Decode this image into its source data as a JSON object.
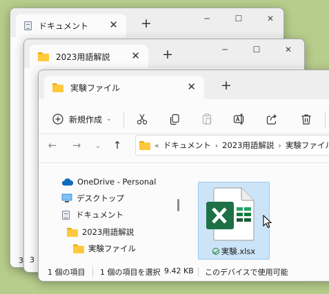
{
  "colors": {
    "desktop": "#b6cd8b",
    "selection": "#cce4f7",
    "excel": "#1e7145"
  },
  "windows": {
    "back": {
      "tab_title": "ドキュメント",
      "tab_icon": "document-icon",
      "status_fragment": "3"
    },
    "middle": {
      "tab_title": "2023用語解説",
      "tab_icon": "folder-icon",
      "status_fragment": "3"
    },
    "front": {
      "tab_title": "実験ファイル",
      "tab_icon": "folder-icon",
      "toolbar": {
        "new_label": "新規作成",
        "buttons": [
          "cut-icon",
          "copy-icon",
          "paste-icon",
          "rename-icon",
          "share-icon",
          "delete-icon"
        ]
      },
      "address": {
        "overflow": "«",
        "crumbs": [
          "ドキュメント",
          "2023用語解説",
          "実験ファイル"
        ]
      },
      "tree": [
        {
          "label": "OneDrive - Personal",
          "icon": "cloud-icon"
        },
        {
          "label": "デスクトップ",
          "icon": "desktop-icon"
        },
        {
          "label": "ドキュメント",
          "icon": "document-icon"
        },
        {
          "label": "2023用語解説",
          "icon": "folder-icon"
        },
        {
          "label": "実験ファイル",
          "icon": "folder-icon"
        }
      ],
      "files": [
        {
          "name": "実験.xlsx",
          "icon": "excel-file-icon",
          "status": "synced-icon"
        }
      ],
      "status": {
        "count": "1 個の項目",
        "selected": "1 個の項目を選択",
        "size": "9.42 KB",
        "availability": "このデバイスで使用可能"
      }
    }
  }
}
